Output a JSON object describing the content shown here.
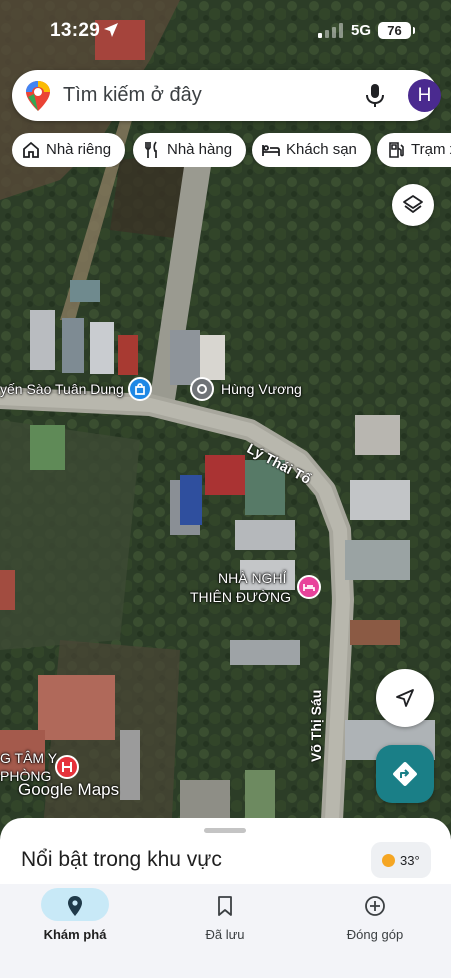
{
  "status_bar": {
    "time": "13:29",
    "network": "5G",
    "battery": "76"
  },
  "search": {
    "placeholder": "Tìm kiếm ở đây",
    "avatar_letter": "H"
  },
  "chips": [
    {
      "label": "Nhà riêng",
      "icon": "home-icon"
    },
    {
      "label": "Nhà hàng",
      "icon": "restaurant-icon"
    },
    {
      "label": "Khách sạn",
      "icon": "hotel-icon"
    },
    {
      "label": "Trạm x",
      "icon": "gas-station-icon"
    }
  ],
  "map_labels": {
    "poi_left": "yến Sào Tuân Dung",
    "poi_place": "Hùng Vương",
    "road_ly_thai_to": "Lý Thái Tổ",
    "road_vo_thi_sau": "Võ Thị Sáu",
    "hotel_line1": "NHÀ NGHỈ",
    "hotel_line2": "THIÊN ĐƯỜNG",
    "hospital_line1": "G TÂM Y",
    "hospital_line2": "PHÒNG",
    "watermark": "Google Maps"
  },
  "colors": {
    "accent": "#1a7f87",
    "avatar": "#4a2a8f",
    "hotel_pin": "#e8439b",
    "hospital_pin": "#e5323b",
    "shop_pin": "#1e88e5"
  },
  "sheet": {
    "title": "Nổi bật trong khu vực",
    "temperature": "33°"
  },
  "nav": [
    {
      "label": "Khám phá",
      "icon": "explore-pin-icon",
      "active": true
    },
    {
      "label": "Đã lưu",
      "icon": "bookmark-icon",
      "active": false
    },
    {
      "label": "Đóng góp",
      "icon": "add-circle-icon",
      "active": false
    }
  ]
}
